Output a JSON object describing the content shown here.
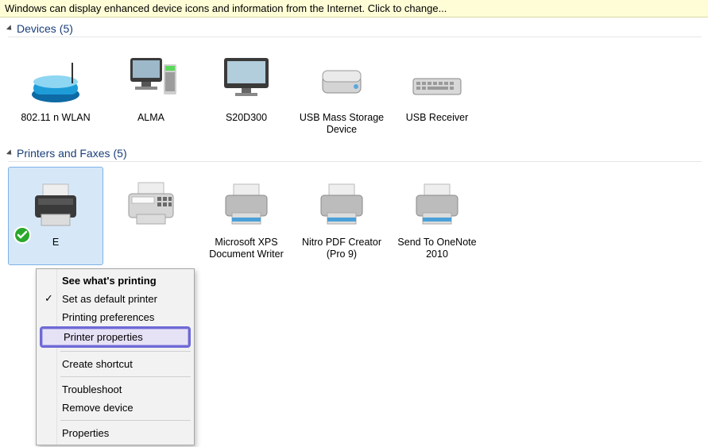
{
  "info_bar": {
    "text": "Windows can display enhanced device icons and information from the Internet. Click to change..."
  },
  "sections": {
    "devices": {
      "title": "Devices",
      "count": "(5)"
    },
    "printers": {
      "title": "Printers and Faxes",
      "count": "(5)"
    }
  },
  "devices": [
    {
      "label": "802.11 n WLAN",
      "icon": "router-icon"
    },
    {
      "label": "ALMA",
      "icon": "desktop-computer-icon"
    },
    {
      "label": "S20D300",
      "icon": "monitor-icon"
    },
    {
      "label": "USB Mass Storage Device",
      "icon": "external-drive-icon"
    },
    {
      "label": "USB Receiver",
      "icon": "keyboard-icon"
    }
  ],
  "printers": [
    {
      "label": "E",
      "icon": "printer-icon",
      "selected": true,
      "default": true
    },
    {
      "label": "",
      "icon": "fax-icon"
    },
    {
      "label": "Microsoft XPS Document Writer",
      "icon": "printer-icon"
    },
    {
      "label": "Nitro PDF Creator (Pro 9)",
      "icon": "printer-icon"
    },
    {
      "label": "Send To OneNote 2010",
      "icon": "printer-icon"
    }
  ],
  "context_menu": {
    "items": [
      {
        "label": "See what's printing",
        "bold": true
      },
      {
        "label": "Set as default printer",
        "checked": true
      },
      {
        "label": "Printing preferences"
      },
      {
        "label": "Printer properties",
        "highlight": true
      },
      {
        "sep": true
      },
      {
        "label": "Create shortcut"
      },
      {
        "sep": true
      },
      {
        "label": "Troubleshoot"
      },
      {
        "label": "Remove device"
      },
      {
        "sep": true
      },
      {
        "label": "Properties"
      }
    ]
  }
}
